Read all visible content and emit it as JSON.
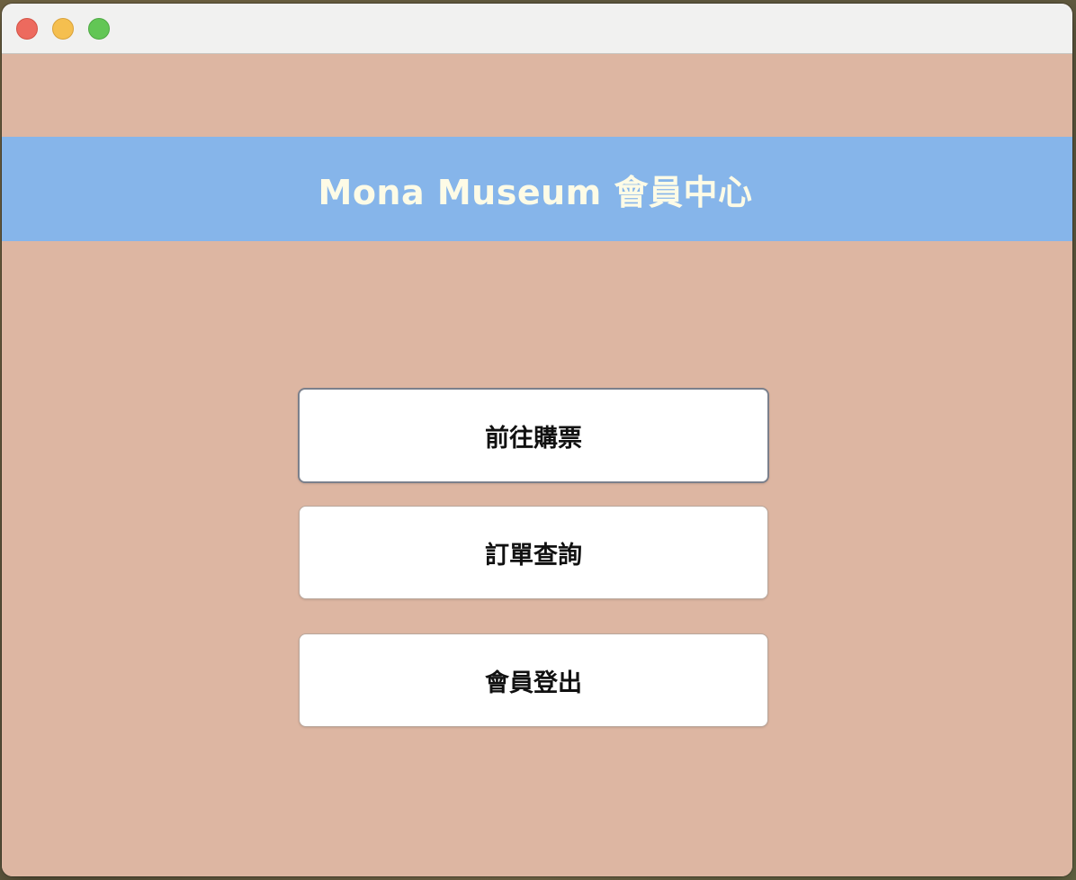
{
  "window": {
    "controls": [
      "close",
      "minimize",
      "maximize"
    ]
  },
  "header": {
    "title": "Mona Museum 會員中心"
  },
  "menu": {
    "buy_tickets_label": "前往購票",
    "order_query_label": "訂單查詢",
    "logout_label": "會員登出"
  },
  "colors": {
    "background": "#ddb6a2",
    "banner": "#86b5ea",
    "banner_text": "#fdfbe6",
    "button": "#ffffff"
  }
}
